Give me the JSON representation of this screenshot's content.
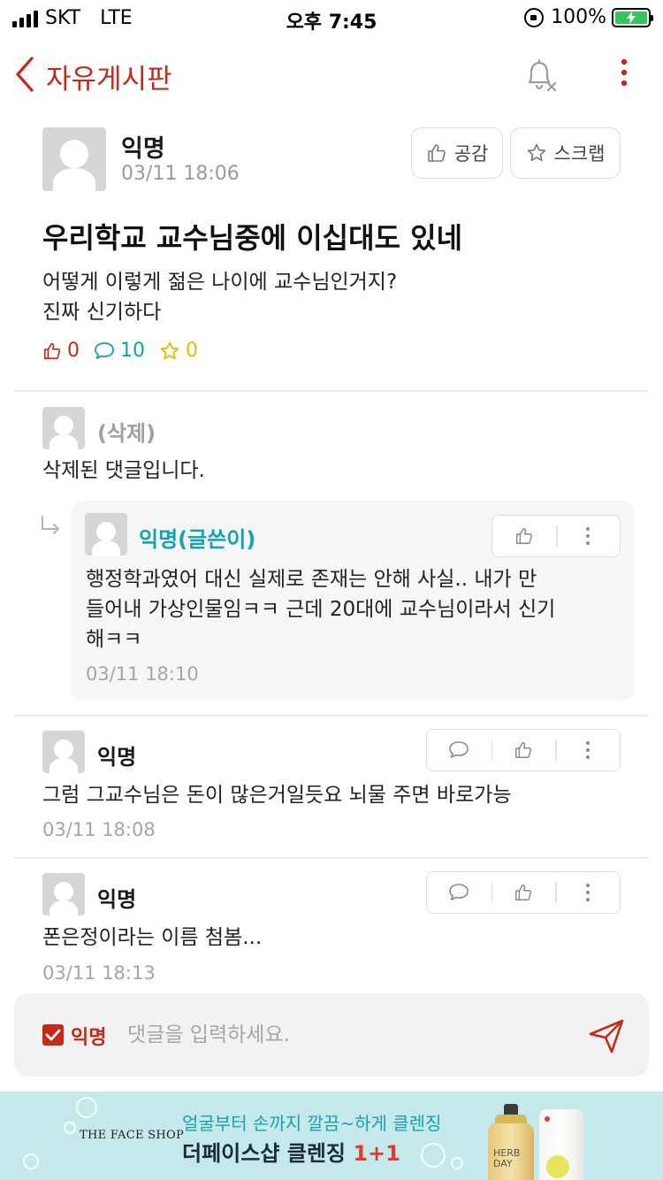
{
  "status_bar": {
    "carrier": "SKT",
    "network": "LTE",
    "time": "오후 7:45",
    "battery": "100%"
  },
  "header": {
    "title": "자유게시판",
    "icons": [
      "chevron-left-icon",
      "bell-off-icon",
      "more-vertical-icon"
    ]
  },
  "post": {
    "author": "익명",
    "time": "03/11 18:06",
    "like_button": "공감",
    "scrap_button": "스크랩",
    "title": "우리학교 교수님중에 이십대도 있네",
    "body_lines": [
      "어떻게 이렇게 젊은 나이에 교수님인거지?",
      "진짜 신기하다"
    ],
    "stats": {
      "likes": "0",
      "comments": "10",
      "scraps": "0"
    }
  },
  "comments": [
    {
      "author": "(삭제)",
      "text": "삭제된 댓글입니다."
    },
    {
      "author": "익명(글쓴이)",
      "text_lines": [
        "행정학과였어 대신 실제로 존재는 안해 사실..  내가 만",
        "들어내 가상인물임ㅋㅋ 근데 20대에 교수님이라서 신기",
        "해ㅋㅋ"
      ],
      "time": "03/11 18:10"
    },
    {
      "author": "익명",
      "text": "그럼 그교수님은 돈이 많은거일듯요 뇌물 주면 바로가능",
      "time": "03/11 18:08"
    },
    {
      "author": "익명",
      "text": "폰은정이라는 이름 첨봄...",
      "time": "03/11 18:13"
    }
  ],
  "input_bar": {
    "anonymous_label": "익명",
    "placeholder": "댓글을 입력하세요.",
    "anonymous_checked": true
  },
  "ad": {
    "brand": "THE FACE SHOP",
    "line1": "얼굴부터 손까지 깔끔~하게 클렌징",
    "line2_main": "더페이스샵 클렌징 ",
    "line2_accent": "1+1",
    "product_text": "HERB DAY"
  },
  "colors": {
    "accent": "#c62917",
    "teal": "#0fa3b5",
    "star": "#f0b400",
    "ad_bg": "#c5e8ea"
  }
}
